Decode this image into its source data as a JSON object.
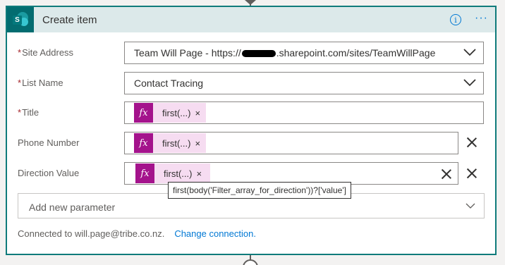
{
  "card": {
    "title": "Create item",
    "app_icon": "sharepoint-icon",
    "header_icons": [
      "info-icon",
      "more-options-icon"
    ]
  },
  "fields": [
    {
      "label": "Site Address",
      "required": true,
      "value_prefix": "Team Will Page - https://",
      "value_suffix": ".sharepoint.com/sites/TeamWillPage",
      "type": "dropdown"
    },
    {
      "label": "List Name",
      "required": true,
      "value": "Contact Tracing",
      "type": "dropdown"
    },
    {
      "label": "Title",
      "required": true,
      "token": "first(...)",
      "token_remove": "×",
      "type": "expression"
    },
    {
      "label": "Phone Number",
      "required": false,
      "token": "first(...)",
      "token_remove": "×",
      "type": "expression"
    },
    {
      "label": "Direction Value",
      "required": false,
      "token": "first(...)",
      "token_remove": "×",
      "type": "expression"
    }
  ],
  "tooltip": "first(body('Filter_array_for_direction'))?['value']",
  "add_parameter": {
    "placeholder": "Add new parameter"
  },
  "footer": {
    "connected_text": "Connected to will.page@tribe.co.nz.",
    "change_link": "Change connection."
  },
  "colors": {
    "accent": "#0078d4",
    "card_border": "#0f7b7b",
    "header_bg": "#dce9ea",
    "expression_token": "#a4138c",
    "token_bg": "#f6dcf1",
    "required": "#a4262c"
  }
}
